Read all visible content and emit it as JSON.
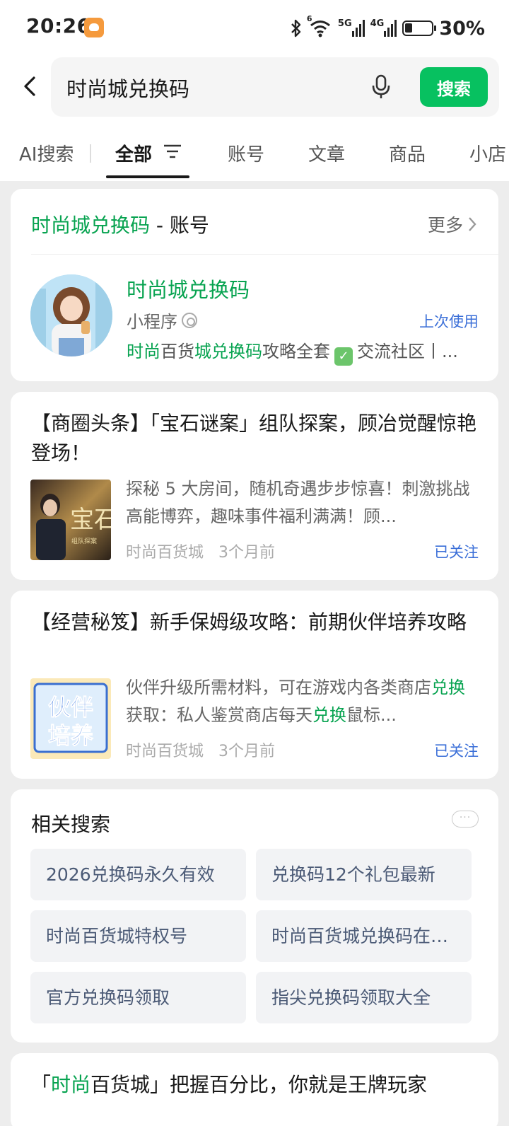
{
  "status_bar": {
    "time": "20:26",
    "network_5g": "5G",
    "network_4g": "4G",
    "wifi_sub": "6",
    "battery": "30%"
  },
  "search": {
    "query": "时尚城兑换码",
    "button": "搜索"
  },
  "tabs": [
    {
      "label": "AI搜索"
    },
    {
      "label": "全部",
      "active": true
    },
    {
      "label": "账号"
    },
    {
      "label": "文章"
    },
    {
      "label": "商品"
    },
    {
      "label": "小店"
    }
  ],
  "account_card": {
    "title_keyword": "时尚城兑换码",
    "title_suffix": " - 账号",
    "more": "更多",
    "name": "时尚城兑换码",
    "type": "小程序",
    "last_used": "上次使用",
    "desc_part1": "时尚",
    "desc_part2": "百货",
    "desc_part3": "城兑换码",
    "desc_part4": "攻略全套",
    "desc_part5": "交流社区丨..."
  },
  "articles": [
    {
      "title": "【商圈头条】「宝石谜案」组队探案，顾冶觉醒惊艳登场！",
      "summary": "探秘 5 大房间，随机奇遇步步惊喜！刺激挑战高能博弈，趣味事件福利满满！顾...",
      "source": "时尚百货城",
      "time": "3个月前",
      "follow": "已关注",
      "thumb_text": "宝石",
      "thumb_sub": "组队探案"
    },
    {
      "title": "【经营秘笈】新手保姆级攻略：前期伙伴培养攻略",
      "summary_p1": "伙伴升级所需材料，可在游戏内各类商店",
      "summary_hl1": "兑换",
      "summary_p2": "获取：私人鉴赏商店每天",
      "summary_hl2": "兑换",
      "summary_p3": "鼠标...",
      "source": "时尚百货城",
      "time": "3个月前",
      "follow": "已关注",
      "thumb_line1": "伙伴",
      "thumb_line2": "培养"
    }
  ],
  "related": {
    "title": "相关搜索",
    "items": [
      "2026兑换码永久有效",
      "兑换码12个礼包最新",
      "时尚百货城特权号",
      "时尚百货城兑换码在线领取",
      "官方兑换码领取",
      "指尖兑换码领取大全"
    ]
  },
  "bottom_article": {
    "open_quote": "「",
    "keyword": "时尚",
    "rest": "百货城」把握百分比，你就是王牌玩家"
  },
  "colors": {
    "accent": "#07c160",
    "link": "#3b6fd8"
  }
}
